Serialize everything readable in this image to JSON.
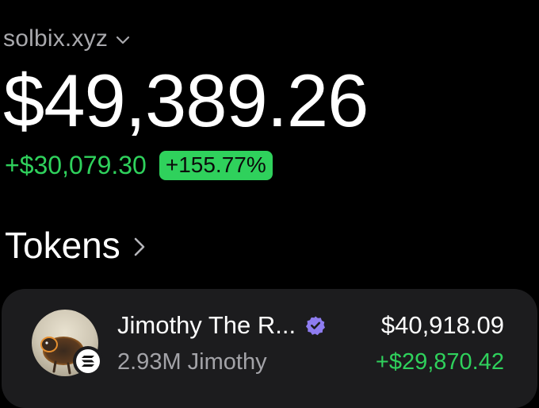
{
  "account": {
    "name": "solbix.xyz",
    "chevron_icon": "chevron-down-icon"
  },
  "portfolio": {
    "balance": "$49,389.26",
    "change_amount": "+$30,079.30",
    "change_percent": "+155.77%"
  },
  "tokens_section": {
    "title": "Tokens",
    "chevron_icon": "chevron-right-icon"
  },
  "tokens": [
    {
      "name": "Jimothy The R...",
      "verified": true,
      "amount": "2.93M Jimothy",
      "value": "$40,918.09",
      "change": "+$29,870.42",
      "chain_icon": "solana-icon"
    }
  ],
  "colors": {
    "background": "#000000",
    "card": "#1c1c1e",
    "positive": "#2fd15c",
    "muted_text": "#a3a3a8",
    "verified": "#8e7cf0"
  }
}
